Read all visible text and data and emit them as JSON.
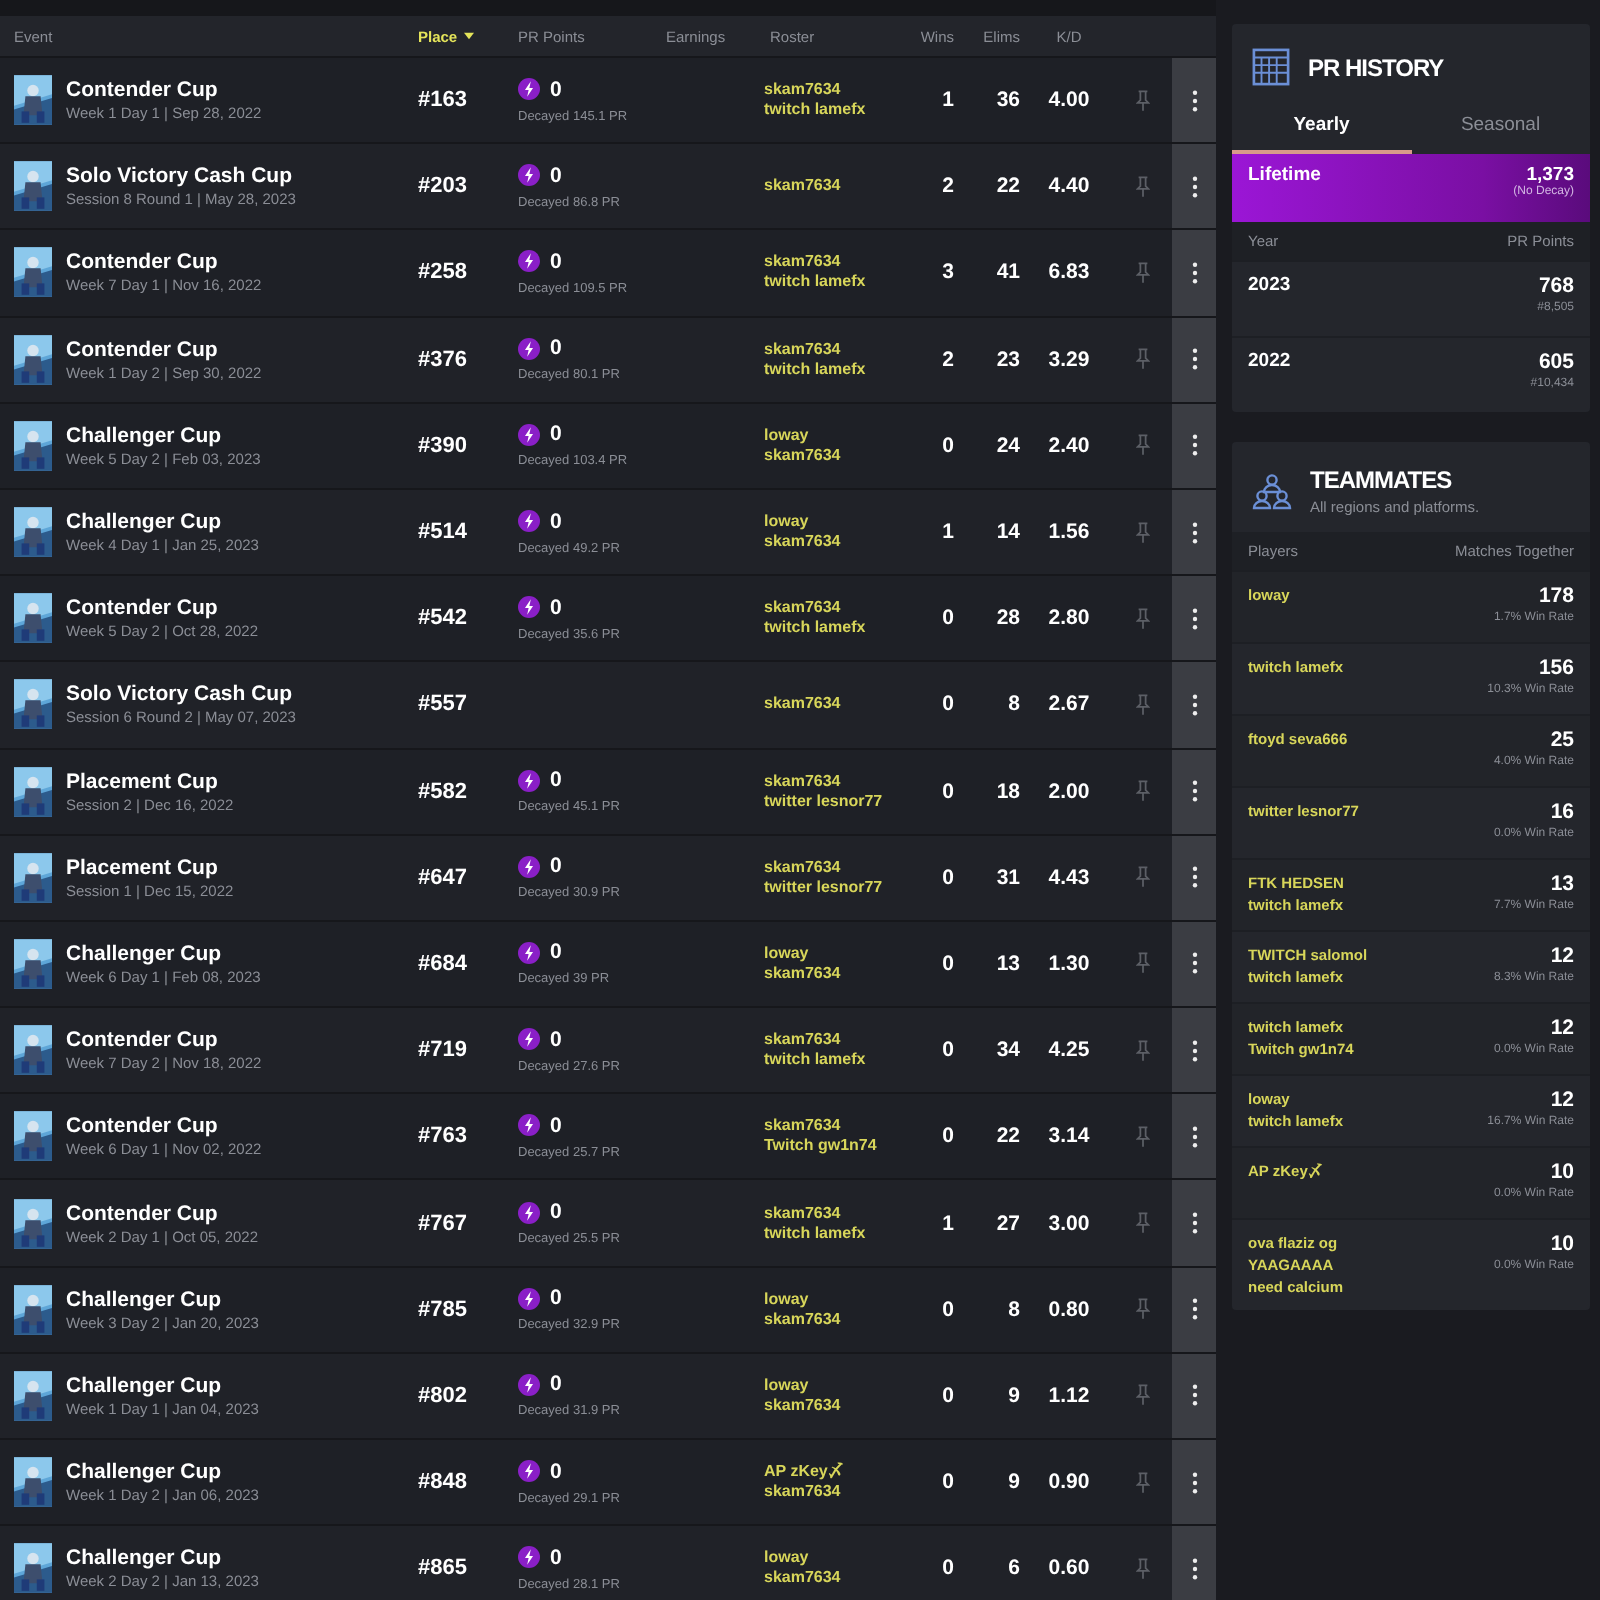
{
  "table": {
    "columns": [
      {
        "label": "Event",
        "sorted": false
      },
      {
        "label": "Place",
        "sorted": true
      },
      {
        "label": "PR Points",
        "sorted": false
      },
      {
        "label": "Earnings",
        "sorted": false
      },
      {
        "label": "Roster",
        "sorted": false
      },
      {
        "label": "Wins",
        "sorted": false
      },
      {
        "label": "Elims",
        "sorted": false
      },
      {
        "label": "K/D",
        "sorted": false
      }
    ],
    "rows": [
      {
        "event": "Contender Cup",
        "details": "Week 1 Day 1 | Sep 28, 2022",
        "place": "#163",
        "pr_points": "0",
        "decayed": "Decayed 145.1 PR",
        "roster": [
          "skam7634",
          "twitch lamefx"
        ],
        "wins": "1",
        "elims": "36",
        "kd": "4.00"
      },
      {
        "event": "Solo Victory Cash Cup",
        "details": "Session 8 Round 1 | May 28, 2023",
        "place": "#203",
        "pr_points": "0",
        "decayed": "Decayed 86.8 PR",
        "roster": [
          "skam7634"
        ],
        "wins": "2",
        "elims": "22",
        "kd": "4.40"
      },
      {
        "event": "Contender Cup",
        "details": "Week 7 Day 1 | Nov 16, 2022",
        "place": "#258",
        "pr_points": "0",
        "decayed": "Decayed 109.5 PR",
        "roster": [
          "skam7634",
          "twitch lamefx"
        ],
        "wins": "3",
        "elims": "41",
        "kd": "6.83"
      },
      {
        "event": "Contender Cup",
        "details": "Week 1 Day 2 | Sep 30, 2022",
        "place": "#376",
        "pr_points": "0",
        "decayed": "Decayed 80.1 PR",
        "roster": [
          "skam7634",
          "twitch lamefx"
        ],
        "wins": "2",
        "elims": "23",
        "kd": "3.29"
      },
      {
        "event": "Challenger Cup",
        "details": "Week 5 Day 2 | Feb 03, 2023",
        "place": "#390",
        "pr_points": "0",
        "decayed": "Decayed 103.4 PR",
        "roster": [
          "loway",
          "skam7634"
        ],
        "wins": "0",
        "elims": "24",
        "kd": "2.40"
      },
      {
        "event": "Challenger Cup",
        "details": "Week 4 Day 1 | Jan 25, 2023",
        "place": "#514",
        "pr_points": "0",
        "decayed": "Decayed 49.2 PR",
        "roster": [
          "loway",
          "skam7634"
        ],
        "wins": "1",
        "elims": "14",
        "kd": "1.56"
      },
      {
        "event": "Contender Cup",
        "details": "Week 5 Day 2 | Oct 28, 2022",
        "place": "#542",
        "pr_points": "0",
        "decayed": "Decayed 35.6 PR",
        "roster": [
          "skam7634",
          "twitch lamefx"
        ],
        "wins": "0",
        "elims": "28",
        "kd": "2.80"
      },
      {
        "event": "Solo Victory Cash Cup",
        "details": "Session 6 Round 2 | May 07, 2023",
        "place": "#557",
        "roster": [
          "skam7634"
        ],
        "wins": "0",
        "elims": "8",
        "kd": "2.67"
      },
      {
        "event": "Placement Cup",
        "details": "Session 2 | Dec 16, 2022",
        "place": "#582",
        "pr_points": "0",
        "decayed": "Decayed 45.1 PR",
        "roster": [
          "skam7634",
          "twitter lesnor77"
        ],
        "wins": "0",
        "elims": "18",
        "kd": "2.00"
      },
      {
        "event": "Placement Cup",
        "details": "Session 1 | Dec 15, 2022",
        "place": "#647",
        "pr_points": "0",
        "decayed": "Decayed 30.9 PR",
        "roster": [
          "skam7634",
          "twitter lesnor77"
        ],
        "wins": "0",
        "elims": "31",
        "kd": "4.43"
      },
      {
        "event": "Challenger Cup",
        "details": "Week 6 Day 1 | Feb 08, 2023",
        "place": "#684",
        "pr_points": "0",
        "decayed": "Decayed 39 PR",
        "roster": [
          "loway",
          "skam7634"
        ],
        "wins": "0",
        "elims": "13",
        "kd": "1.30"
      },
      {
        "event": "Contender Cup",
        "details": "Week 7 Day 2 | Nov 18, 2022",
        "place": "#719",
        "pr_points": "0",
        "decayed": "Decayed 27.6 PR",
        "roster": [
          "skam7634",
          "twitch lamefx"
        ],
        "wins": "0",
        "elims": "34",
        "kd": "4.25"
      },
      {
        "event": "Contender Cup",
        "details": "Week 6 Day 1 | Nov 02, 2022",
        "place": "#763",
        "pr_points": "0",
        "decayed": "Decayed 25.7 PR",
        "roster": [
          "skam7634",
          "Twitch gw1n74"
        ],
        "wins": "0",
        "elims": "22",
        "kd": "3.14"
      },
      {
        "event": "Contender Cup",
        "details": "Week 2 Day 1 | Oct 05, 2022",
        "place": "#767",
        "pr_points": "0",
        "decayed": "Decayed 25.5 PR",
        "roster": [
          "skam7634",
          "twitch lamefx"
        ],
        "wins": "1",
        "elims": "27",
        "kd": "3.00"
      },
      {
        "event": "Challenger Cup",
        "details": "Week 3 Day 2 | Jan 20, 2023",
        "place": "#785",
        "pr_points": "0",
        "decayed": "Decayed 32.9 PR",
        "roster": [
          "loway",
          "skam7634"
        ],
        "wins": "0",
        "elims": "8",
        "kd": "0.80"
      },
      {
        "event": "Challenger Cup",
        "details": "Week 1 Day 1 | Jan 04, 2023",
        "place": "#802",
        "pr_points": "0",
        "decayed": "Decayed 31.9 PR",
        "roster": [
          "loway",
          "skam7634"
        ],
        "wins": "0",
        "elims": "9",
        "kd": "1.12"
      },
      {
        "event": "Challenger Cup",
        "details": "Week 1 Day 2 | Jan 06, 2023",
        "place": "#848",
        "pr_points": "0",
        "decayed": "Decayed 29.1 PR",
        "roster": [
          "AP zKey〆",
          "skam7634"
        ],
        "wins": "0",
        "elims": "9",
        "kd": "0.90"
      },
      {
        "event": "Challenger Cup",
        "details": "Week 2 Day 2 | Jan 13, 2023",
        "place": "#865",
        "pr_points": "0",
        "decayed": "Decayed 28.1 PR",
        "roster": [
          "loway",
          "skam7634"
        ],
        "wins": "0",
        "elims": "6",
        "kd": "0.60"
      }
    ]
  },
  "pr_history": {
    "title": "PR HISTORY",
    "tabs": [
      {
        "label": "Yearly",
        "selected": true
      },
      {
        "label": "Seasonal",
        "selected": false
      }
    ],
    "lifetime": {
      "label": "Lifetime",
      "value": "1,373",
      "note": "(No Decay)"
    },
    "columns": [
      "Year",
      "PR Points"
    ],
    "rows": [
      {
        "year": "2023",
        "points": "768",
        "rank": "#8,505"
      },
      {
        "year": "2022",
        "points": "605",
        "rank": "#10,434"
      }
    ]
  },
  "teammates": {
    "title": "TEAMMATES",
    "subtitle": "All regions and platforms.",
    "columns": [
      "Players",
      "Matches Together"
    ],
    "rows": [
      {
        "players": [
          "loway"
        ],
        "matches": "178",
        "win_rate": "1.7% Win Rate"
      },
      {
        "players": [
          "twitch lamefx"
        ],
        "matches": "156",
        "win_rate": "10.3% Win Rate"
      },
      {
        "players": [
          "ftoyd seva666"
        ],
        "matches": "25",
        "win_rate": "4.0% Win Rate"
      },
      {
        "players": [
          "twitter lesnor77"
        ],
        "matches": "16",
        "win_rate": "0.0% Win Rate"
      },
      {
        "players": [
          "FTK HEDSEN",
          "twitch lamefx"
        ],
        "matches": "13",
        "win_rate": "7.7% Win Rate"
      },
      {
        "players": [
          "TWITCH salomol",
          "twitch lamefx"
        ],
        "matches": "12",
        "win_rate": "8.3% Win Rate"
      },
      {
        "players": [
          "twitch lamefx",
          "Twitch gw1n74"
        ],
        "matches": "12",
        "win_rate": "0.0% Win Rate"
      },
      {
        "players": [
          "loway",
          "twitch lamefx"
        ],
        "matches": "12",
        "win_rate": "16.7% Win Rate"
      },
      {
        "players": [
          "AP zKey〆"
        ],
        "matches": "10",
        "win_rate": "0.0% Win Rate"
      },
      {
        "players": [
          "ova flaziz og",
          "YAAGAAAA",
          "need calcium"
        ],
        "matches": "10",
        "win_rate": "0.0% Win Rate"
      }
    ]
  }
}
